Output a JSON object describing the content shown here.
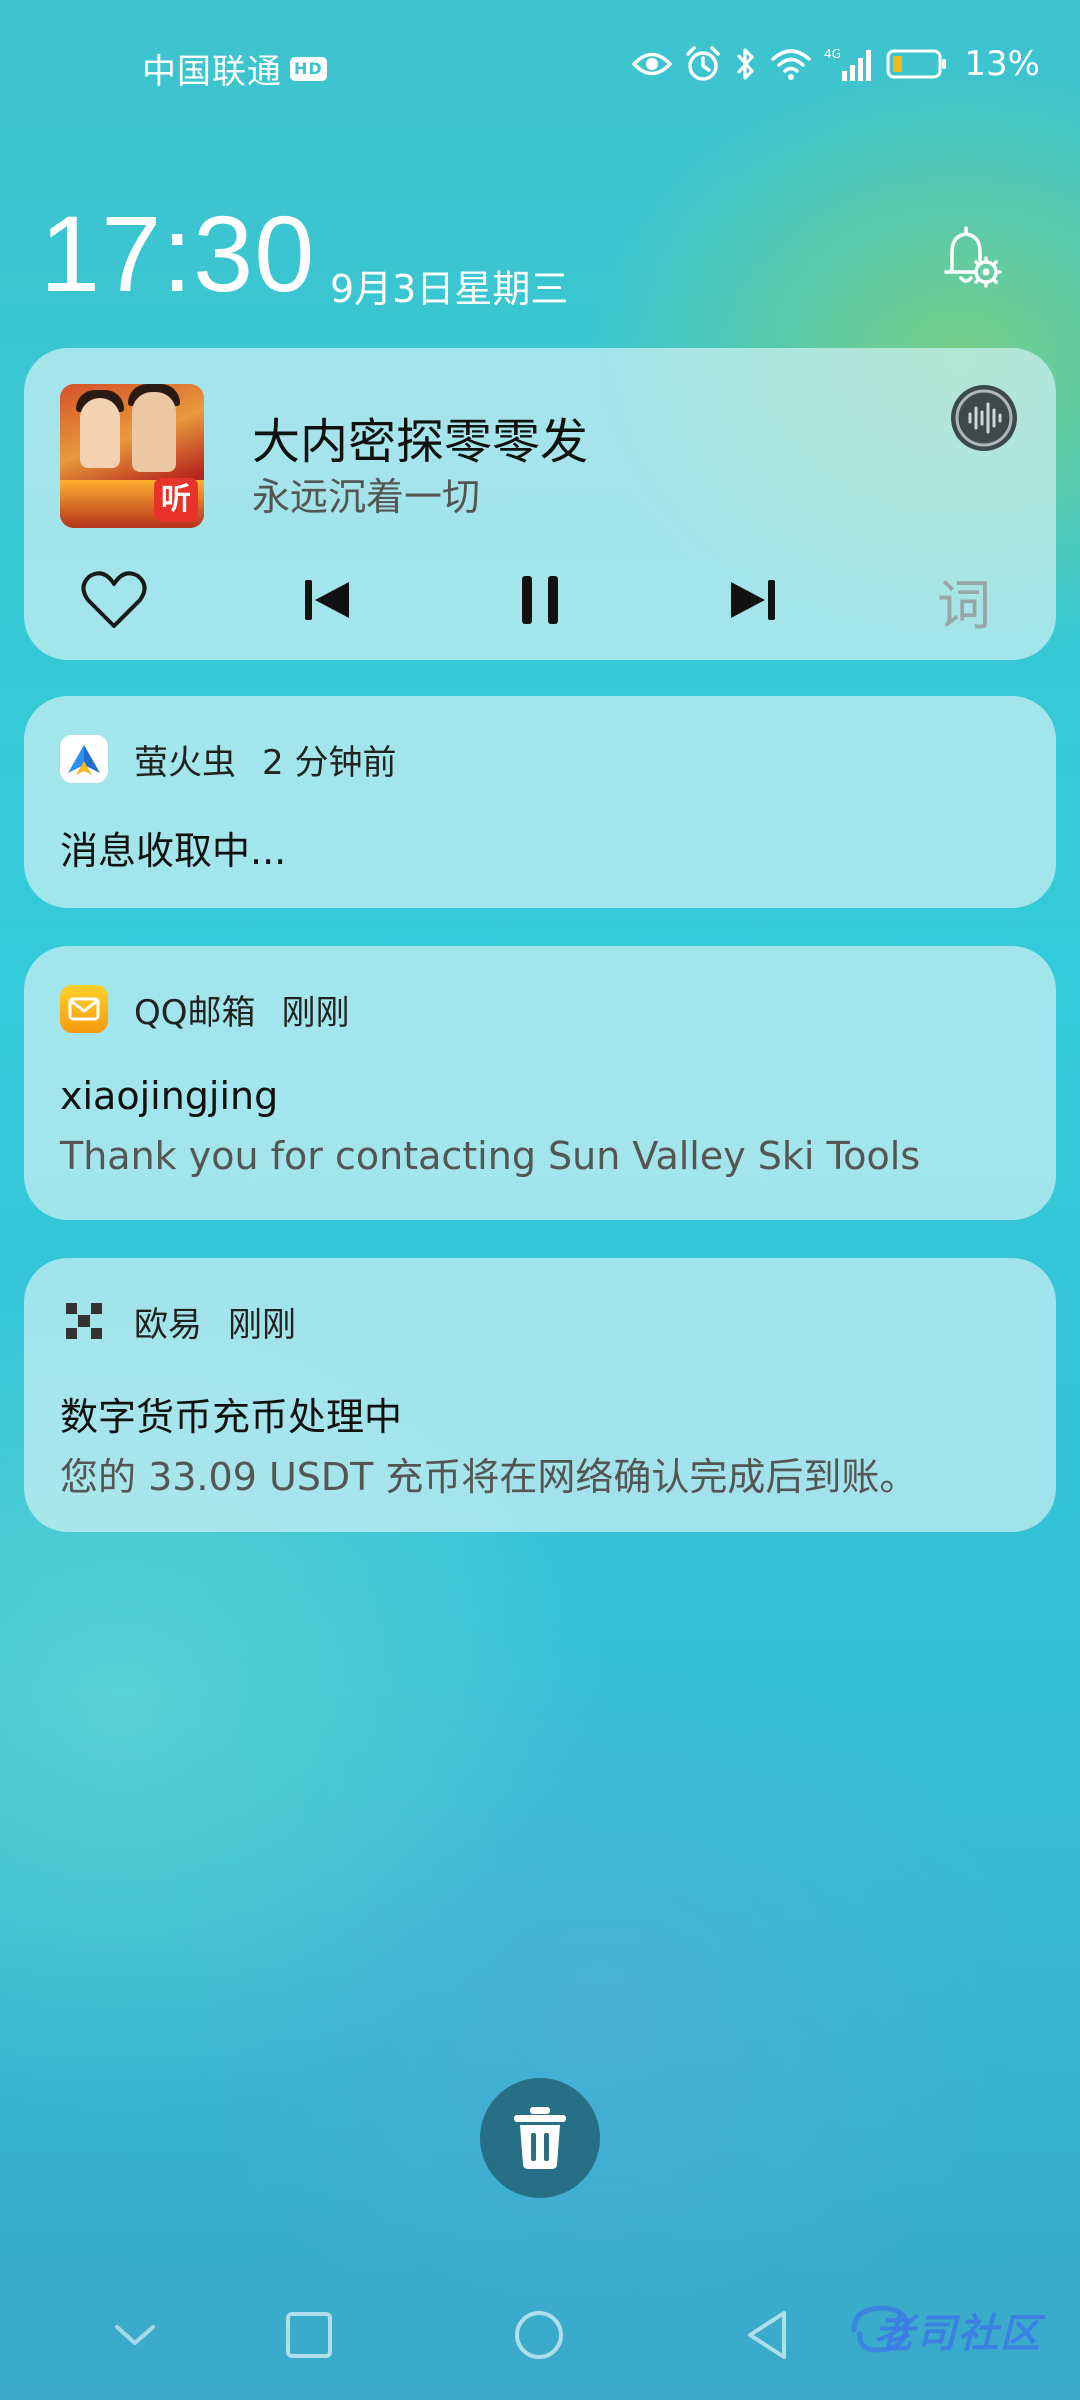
{
  "status_bar": {
    "carrier": "中国联通",
    "hd_badge": "HD",
    "network": "4G",
    "battery_percent": "13%",
    "battery_level": 0.13
  },
  "header": {
    "time": "17:30",
    "date": "9月3日星期三"
  },
  "music": {
    "song_title": "大内密探零零发",
    "subtitle": "永远沉着一切",
    "album_badge": "听",
    "lyrics_label": "词"
  },
  "notifications": [
    {
      "app": "萤火虫",
      "time": "2 分钟前",
      "title": "消息收取中...",
      "body": ""
    },
    {
      "app": "QQ邮箱",
      "time": "刚刚",
      "title": "xiaojingjing",
      "body": "Thank you for contacting Sun Valley Ski Tools"
    },
    {
      "app": "欧易",
      "time": "刚刚",
      "title": "数字货币充币处理中",
      "body": "您的 33.09 USDT 充币将在网络确认完成后到账。"
    }
  ],
  "watermark": "老司社区",
  "colors": {
    "accent_yellow": "#f7b61b",
    "firefly_blue": "#2f8ff0",
    "delete_button": "#1e5a6e"
  }
}
